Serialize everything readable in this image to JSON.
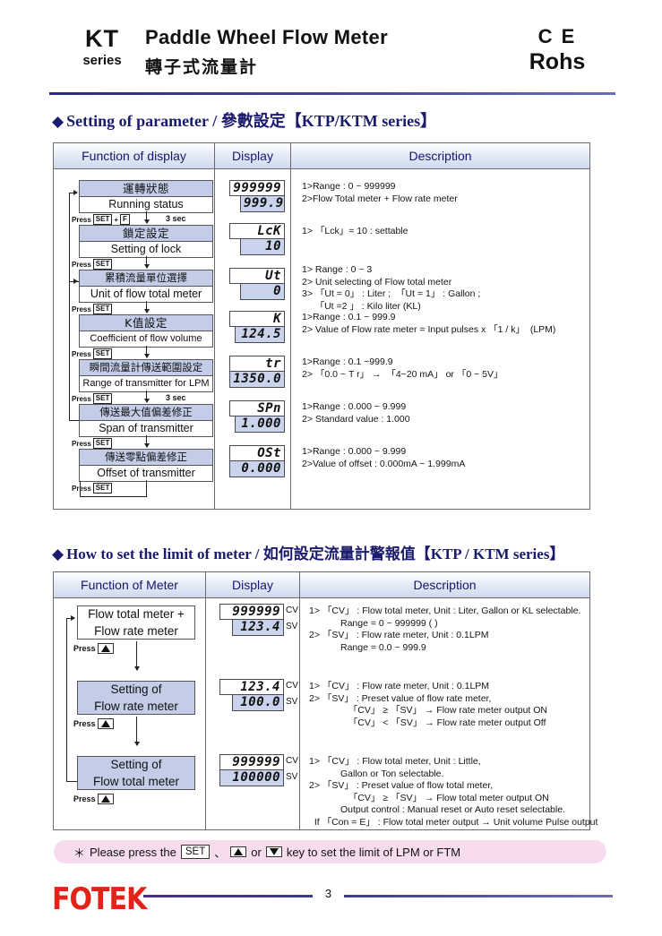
{
  "header": {
    "series_main": "KT",
    "series_sub": "series",
    "title_en": "Paddle Wheel Flow Meter",
    "title_cn": "轉子式流量計",
    "ce_mark": "C E",
    "rohs": "Rohs"
  },
  "section1": {
    "diamond": "◆",
    "title": "Setting of parameter / 參數設定【KTP/KTM series】",
    "columns": [
      "Function of display",
      "Display",
      "Description"
    ],
    "rows": [
      {
        "cn": "運轉狀態",
        "en": "Running status",
        "press": "Press",
        "keys": [
          "SET",
          "F"
        ],
        "press_join": "+",
        "sec": "3 sec",
        "lcd_top": "999999",
        "lcd_bot": "999.9",
        "desc": "1>Range : 0 ~ 999999\n2>Flow Total meter + Flow rate meter"
      },
      {
        "cn": "鎖定設定",
        "en": "Setting of lock",
        "press": "Press",
        "keys": [
          "SET"
        ],
        "sec": "",
        "lcd_top": "LcK",
        "lcd_bot": "10",
        "desc": "1> 「Lck」= 10 : settable"
      },
      {
        "cn": "累積流量單位選擇",
        "en": "Unit of flow total meter",
        "press": "Press",
        "keys": [
          "SET"
        ],
        "sec": "",
        "lcd_top": "Ut",
        "lcd_bot": "0",
        "desc": "1> Range : 0 ~ 3\n2> Unit selecting of Flow total meter\n3> 「Ut = 0」 : Liter ;  「Ut = 1」 : Gallon ;\n     「Ut =2 」 : Kilo liter (KL)"
      },
      {
        "cn": "K值設定",
        "en": "Coefficient of flow volume",
        "press": "Press",
        "keys": [
          "SET"
        ],
        "sec": "",
        "lcd_top": "K",
        "lcd_bot": "124.5",
        "desc": "1>Range : 0.1 ~ 999.9\n2> Value of Flow rate meter = Input pulses x 「1 / k」  (LPM)"
      },
      {
        "cn": "瞬間流量計傳送範圍設定",
        "en": "Range of transmitter for LPM",
        "press": "Press",
        "keys": [
          "SET"
        ],
        "sec": "3 sec",
        "lcd_top": "tr",
        "lcd_bot": "1350.0",
        "desc": "1>Range : 0.1 ~999.9\n2> 「0.0 ~ T r」 →  「4~20 mA」 or 「0 ~ 5V」"
      },
      {
        "cn": "傳送最大值偏差修正",
        "en": "Span of transmitter",
        "press": "Press",
        "keys": [
          "SET"
        ],
        "sec": "",
        "lcd_top": "SPn",
        "lcd_bot": "1.000",
        "desc": "1>Range : 0.000 ~ 9.999\n2> Standard value : 1.000"
      },
      {
        "cn": "傳送零點偏差修正",
        "en": "Offset of transmitter",
        "press": "Press",
        "keys": [
          "SET"
        ],
        "sec": "",
        "lcd_top": "OSt",
        "lcd_bot": "0.000",
        "desc": "1>Range : 0.000 ~ 9.999\n2>Value of offset : 0.000mA ~ 1.999mA"
      }
    ]
  },
  "section2": {
    "diamond": "◆",
    "title": "How to set the limit of meter / 如何設定流量計警報值【KTP / KTM series】",
    "columns": [
      "Function of Meter",
      "Display",
      "Description"
    ],
    "rows": [
      {
        "label_line1": "Flow total meter +",
        "label_line2": "Flow rate meter",
        "press": "Press",
        "key_icon": "up-arrow-key",
        "lcd_top": "999999",
        "lcd_bot": "123.4",
        "cv": "CV",
        "sv": "SV",
        "desc": "1> 「CV」 : Flow total meter, Unit : Liter, Gallon or KL selectable.\n            Range = 0 ~ 999999 ( )\n2> 「SV」 : Flow rate meter, Unit : 0.1LPM\n            Range = 0.0 ~ 999.9"
      },
      {
        "label_line1": "Setting of",
        "label_line2": "Flow rate meter",
        "press": "Press",
        "key_icon": "up-arrow-key",
        "lcd_top": "123.4",
        "lcd_bot": "100.0",
        "cv": "CV",
        "sv": "SV",
        "desc": "1> 「CV」 : Flow rate meter, Unit : 0.1LPM\n2> 「SV」 : Preset value of flow rate meter,\n               「CV」 ≥ 「SV」 → Flow rate meter output ON\n               「CV」 < 「SV」 → Flow rate meter output Off"
      },
      {
        "label_line1": "Setting of",
        "label_line2": "Flow total meter",
        "press": "Press",
        "key_icon": "up-arrow-key",
        "lcd_top": "999999",
        "lcd_bot": "100000",
        "cv": "CV",
        "sv": "SV",
        "desc": "1> 「CV」 : Flow total meter, Unit : Little,\n            Gallon or Ton selectable.\n2> 「SV」 : Preset value of flow total meter,\n               「CV」 ≥ 「SV」 → Flow total meter output ON\n            Output control : Manual reset or Auto reset selectable.\n  If 「Con = E」 : Flow total meter output → Unit volume Pulse output"
      }
    ]
  },
  "note": {
    "star": "＊",
    "text1": "Please press the",
    "key_set": "SET",
    "sep": "、",
    "or": "or",
    "text2": "key to set the limit of LPM or FTM"
  },
  "footer": {
    "logo": "FOTEK",
    "page": "3"
  }
}
